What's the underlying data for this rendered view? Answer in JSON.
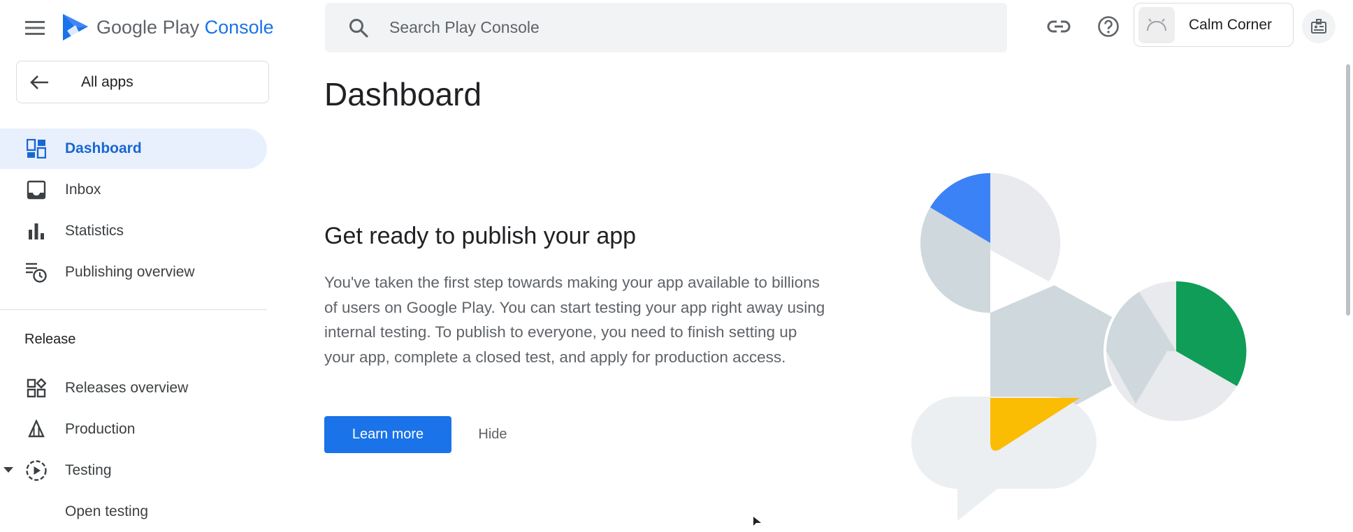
{
  "app": {
    "brand_main": "Google Play",
    "brand_accent": "Console"
  },
  "search": {
    "placeholder": "Search Play Console"
  },
  "account": {
    "name": "Calm Corner"
  },
  "sidebar": {
    "all_apps": "All apps",
    "items": [
      {
        "label": "Dashboard",
        "icon": "dashboard-icon",
        "active": true
      },
      {
        "label": "Inbox",
        "icon": "inbox-icon"
      },
      {
        "label": "Statistics",
        "icon": "bar-chart-icon"
      },
      {
        "label": "Publishing overview",
        "icon": "schedule-list-icon"
      }
    ],
    "release_heading": "Release",
    "release_items": [
      {
        "label": "Releases overview",
        "icon": "widgets-icon"
      },
      {
        "label": "Production",
        "icon": "production-icon"
      },
      {
        "label": "Testing",
        "icon": "testing-icon",
        "expanded": true
      },
      {
        "label": "Open testing",
        "icon": ""
      }
    ]
  },
  "main": {
    "title": "Dashboard",
    "card": {
      "title": "Get ready to publish your app",
      "body": "You've taken the first step towards making your app available to billions of users on Google Play. You can start testing your app right away using internal testing. To publish to everyone, you need to finish setting up your app, complete a closed test, and apply for production access.",
      "primary_label": "Learn more",
      "secondary_label": "Hide"
    }
  },
  "colors": {
    "accent": "#1a73e8",
    "active_bg": "#e8f0fe",
    "green": "#0f9d58",
    "yellow": "#fbbc04"
  }
}
